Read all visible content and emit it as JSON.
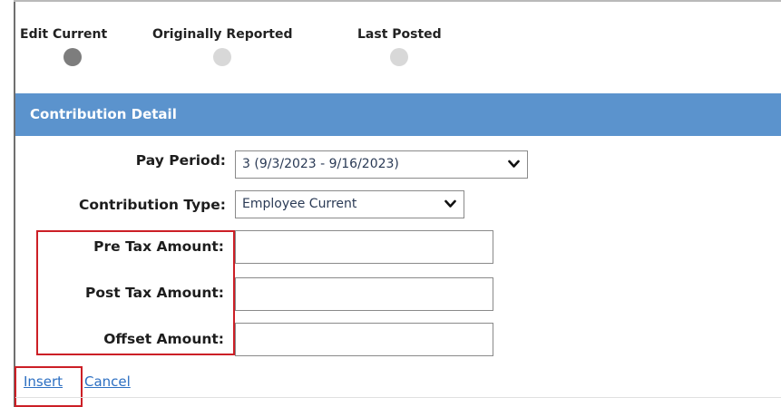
{
  "view_tabs": [
    {
      "label": "Edit Current",
      "active": true
    },
    {
      "label": "Originally Reported",
      "active": false
    },
    {
      "label": "Last Posted",
      "active": false
    }
  ],
  "panel": {
    "title": "Contribution Detail"
  },
  "form": {
    "pay_period": {
      "label": "Pay Period:",
      "value": "3 (9/3/2023 - 9/16/2023)"
    },
    "contribution_type": {
      "label": "Contribution Type:",
      "value": "Employee Current"
    },
    "pre_tax": {
      "label": "Pre Tax Amount:",
      "value": ""
    },
    "post_tax": {
      "label": "Post Tax Amount:",
      "value": ""
    },
    "offset": {
      "label": "Offset Amount:",
      "value": ""
    }
  },
  "actions": {
    "insert": "Insert",
    "cancel": "Cancel"
  },
  "colors": {
    "header_bg": "#5b93cd",
    "link": "#2c6fc2",
    "highlight": "#cc1f26"
  }
}
